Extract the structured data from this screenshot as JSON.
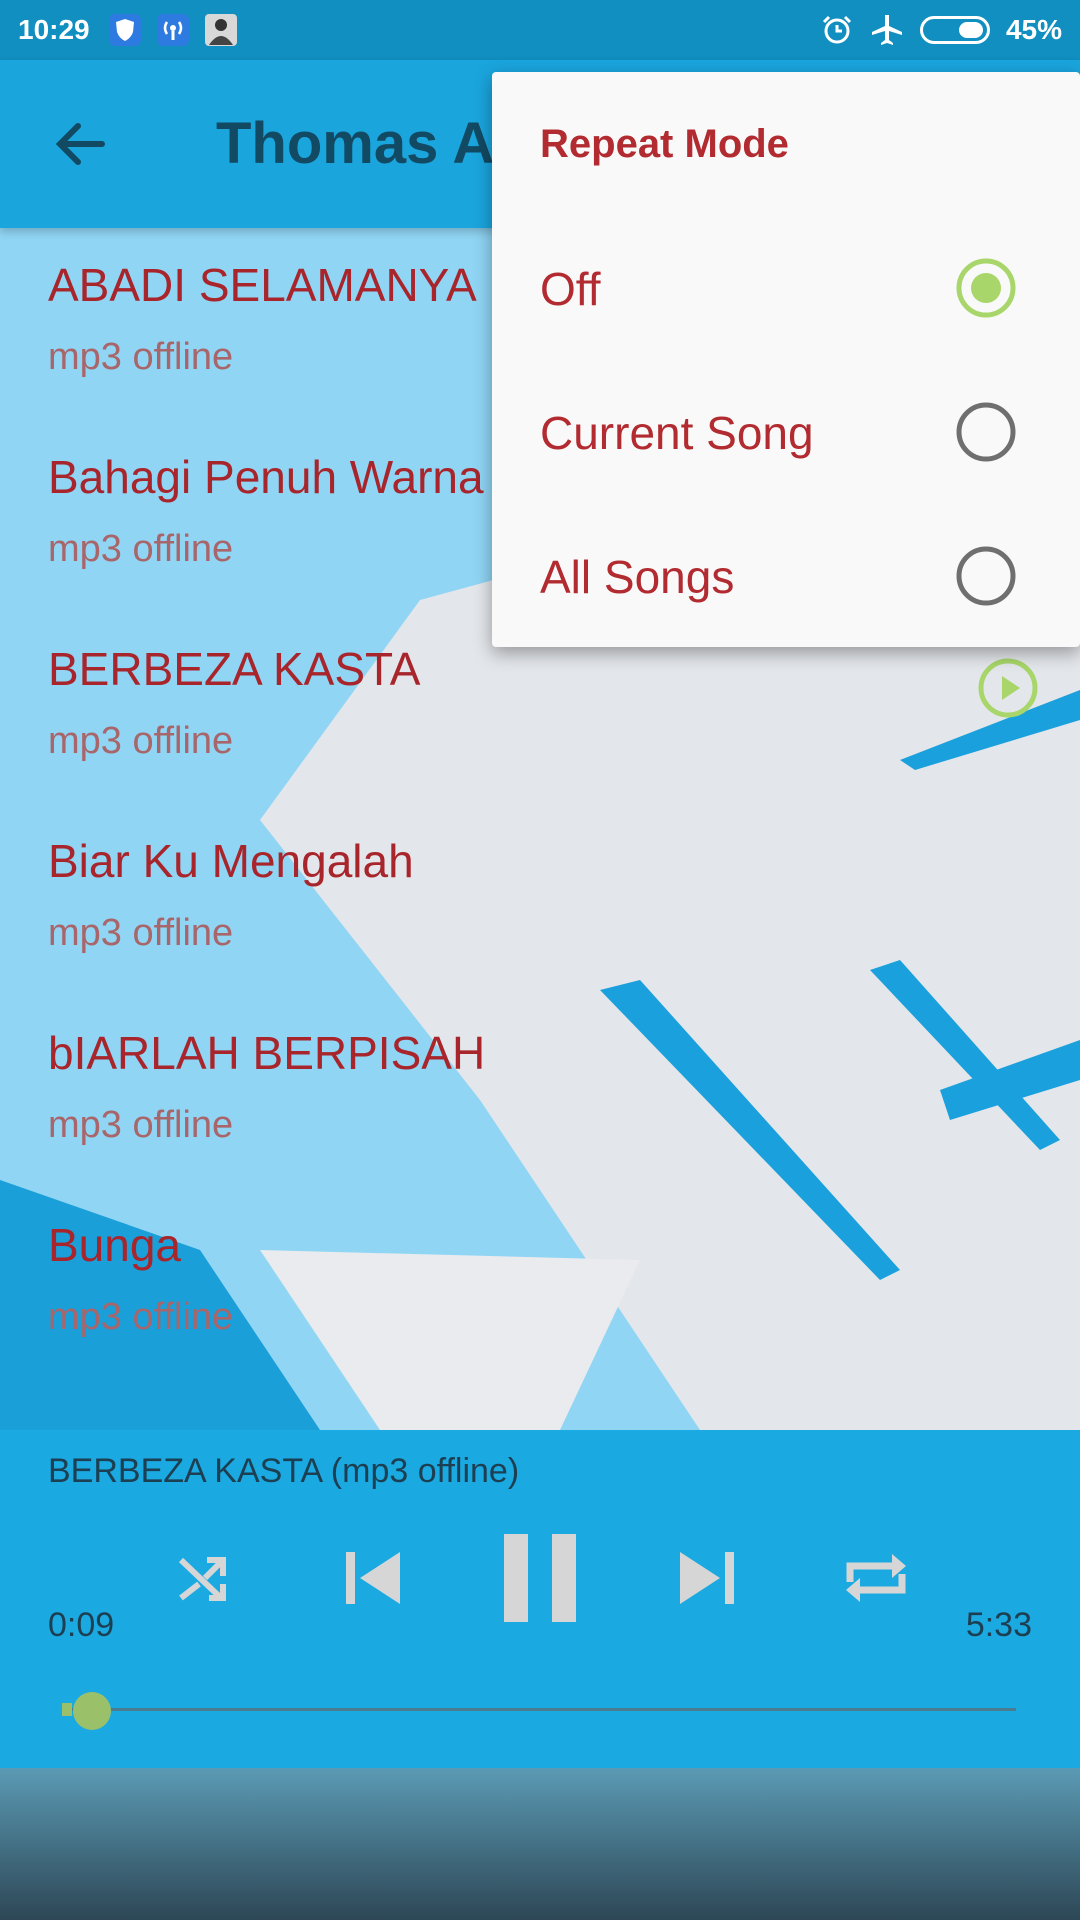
{
  "status_bar": {
    "time": "10:29",
    "battery": "45%"
  },
  "app_bar": {
    "title": "Thomas A",
    "back_icon": "arrow-back-icon"
  },
  "songs": [
    {
      "title": "ABADI SELAMANYA",
      "subtitle": "mp3 offline"
    },
    {
      "title": "Bahagi Penuh Warna",
      "subtitle": "mp3 offline"
    },
    {
      "title": "BERBEZA KASTA",
      "subtitle": "mp3 offline"
    },
    {
      "title": "Biar Ku Mengalah",
      "subtitle": "mp3 offline"
    },
    {
      "title": "bIARLAH BERPISAH",
      "subtitle": "mp3 offline"
    },
    {
      "title": "Bunga",
      "subtitle": "mp3 offline"
    }
  ],
  "player": {
    "now_playing": "BERBEZA KASTA (mp3 offline)",
    "elapsed": "0:09",
    "duration": "5:33",
    "progress_fraction": 0.027
  },
  "repeat_menu": {
    "title": "Repeat Mode",
    "options": [
      {
        "label": "Off",
        "selected": true
      },
      {
        "label": "Current Song",
        "selected": false
      },
      {
        "label": "All Songs",
        "selected": false
      }
    ]
  },
  "colors": {
    "accent_red": "#b22b30",
    "accent_green": "#a8d66a",
    "app_bar_blue": "#1aa5dd"
  }
}
